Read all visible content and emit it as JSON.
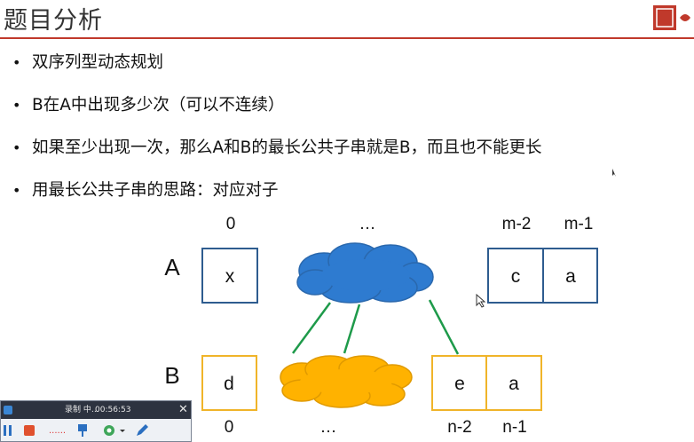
{
  "slide": {
    "title": "题目分析",
    "bullets": [
      "双序列型动态规划",
      "B在A中出现多少次（可以不连续）",
      "如果至少出现一次，那么A和B的最长公共子串就是B，而且也不能更长",
      "用最长公共子串的思路：对应对子"
    ],
    "bullet_char": "•",
    "rule_color": "#c0392b"
  },
  "diagram": {
    "row_a_label": "A",
    "row_b_label": "B",
    "a_indices": {
      "first": "0",
      "middle": "…",
      "second_last": "m-2",
      "last": "m-1"
    },
    "b_indices": {
      "first": "0",
      "middle": "…",
      "second_last": "n-2",
      "last": "n-1"
    },
    "a_cells": {
      "first": "x",
      "second_last": "c",
      "last": "a"
    },
    "b_cells": {
      "first": "d",
      "second_last": "e",
      "last": "a"
    },
    "colors": {
      "a_box": "#2e5c8f",
      "b_box": "#f0b429",
      "cloud_a": "#2e7bd0",
      "cloud_b": "#ffb200",
      "connector": "#1e9a4a"
    }
  },
  "recorder": {
    "title": "录制 中…",
    "time": "00:56:53",
    "close_glyph": "✕",
    "dots": "......"
  }
}
